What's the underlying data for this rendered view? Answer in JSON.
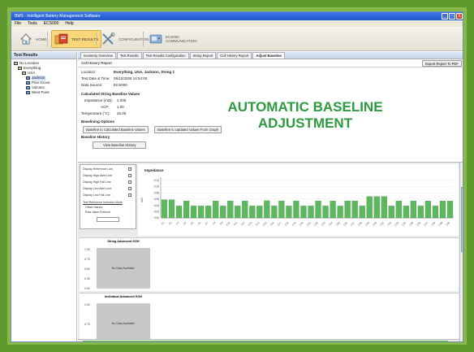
{
  "window": {
    "title": "BMS - Intelligent Battery Management Software",
    "controls": [
      "_",
      "□",
      "X"
    ]
  },
  "menubar": [
    "File",
    "Tools",
    "ECS000",
    "Help"
  ],
  "toolbar": {
    "home": "HOME",
    "test_results": "TEST RESULTS",
    "configuration": "CONFIGURATION",
    "ecs": "ECS000 COMMUNICATION"
  },
  "tree": {
    "header": "Test Results",
    "items": [
      {
        "label": "No Location",
        "depth": 0,
        "selected": false
      },
      {
        "label": "Everything",
        "depth": 1,
        "selected": false
      },
      {
        "label": "USA",
        "depth": 2,
        "selected": false
      },
      {
        "label": "Jackson",
        "depth": 3,
        "selected": true
      },
      {
        "label": "Pine Grove",
        "depth": 3,
        "selected": false
      },
      {
        "label": "Volcano",
        "depth": 3,
        "selected": false
      },
      {
        "label": "West Point",
        "depth": 3,
        "selected": false
      }
    ]
  },
  "tabs": [
    {
      "label": "Inventory Overview",
      "active": false
    },
    {
      "label": "Test Results",
      "active": false
    },
    {
      "label": "Test Results Configuration",
      "active": false
    },
    {
      "label": "String Report",
      "active": false
    },
    {
      "label": "Cell History Report",
      "active": false
    },
    {
      "label": "Adjust Baseline",
      "active": true
    }
  ],
  "report": {
    "title": "Cell History Report",
    "export_label": "Export Report To PDF",
    "location_label": "Location:",
    "location_value": "Everything, USA, Jackson, String 1",
    "test_date_label": "Test Date & Time:",
    "test_date_value": "05/12/2006 14:54:00",
    "data_source_label": "Data Source:",
    "data_source_value": "ECS000",
    "calc_header": "Calculated String Baseline Values",
    "impedance_label": "Impedance (mΩ):",
    "impedance_value": "2.000",
    "acp_label": "ACP:",
    "acp_value": "1.00",
    "temp_label": "Temperature (°C):",
    "temp_value": "25.00",
    "baseline_options_header": "Baselining Options",
    "btn_calc_baseline": "Baseline to Calculated Baseline Values",
    "btn_updated_baseline": "Baseline to Updated Values From Graph",
    "baseline_history_header": "Baseline History",
    "btn_view_history": "View Baseline History"
  },
  "overlay": {
    "line1": "AUTOMATIC BASELINE",
    "line2": "ADJUSTMENT"
  },
  "options": {
    "rows": [
      "Display Reference Line",
      "Display High Alert Line",
      "Display High Fail Line",
      "Display Low Alert Line",
      "Display Low Fail Line"
    ],
    "group_title": "Test Reference Indicator Mode",
    "radios": [
      "Offset Values",
      "Raw Value Entered"
    ]
  },
  "chart_data": {
    "type": "bar",
    "title": "Impedance",
    "ylabel": "mΩ",
    "ylim": [
      0,
      0.13
    ],
    "y_ticks": [
      "0.00",
      "0.02",
      "0.04",
      "0.06",
      "0.08",
      "0.10",
      "0.12"
    ],
    "categories": [
      "C1",
      "C2",
      "C3",
      "C4",
      "C5",
      "C6",
      "C7",
      "C8",
      "C9",
      "C10",
      "C11",
      "C12",
      "C13",
      "C14",
      "C15",
      "C16",
      "C17",
      "C18",
      "C19",
      "C20",
      "C21",
      "C22",
      "C23",
      "C24",
      "C25",
      "C26",
      "C27",
      "C28",
      "C29",
      "C30",
      "C31",
      "C32",
      "C33",
      "C34",
      "C35",
      "C36",
      "C37",
      "C38",
      "C39",
      "C40"
    ],
    "values": [
      0.058,
      0.058,
      0.038,
      0.054,
      0.038,
      0.038,
      0.038,
      0.054,
      0.038,
      0.054,
      0.038,
      0.054,
      0.038,
      0.038,
      0.055,
      0.038,
      0.054,
      0.038,
      0.054,
      0.038,
      0.038,
      0.054,
      0.038,
      0.054,
      0.038,
      0.054,
      0.054,
      0.038,
      0.068,
      0.068,
      0.068,
      0.038,
      0.054,
      0.038,
      0.054,
      0.038,
      0.054,
      0.038,
      0.054,
      0.054
    ],
    "color": "#5cb85c"
  },
  "mini_charts": [
    {
      "title": "String Advanced SOH",
      "y_ticks": [
        "1.00",
        "0.75",
        "0.50",
        "0.25",
        "0.00"
      ],
      "message": "No Data Available."
    },
    {
      "title": "Individual Advanced SOH",
      "y_ticks": [
        "1.00",
        "0.75",
        "0.50"
      ],
      "message": "No Data Available."
    }
  ],
  "colors": {
    "accent_green": "#2e9a3f",
    "bar_green": "#5cb85c",
    "frame_green": "#5e9a2e"
  }
}
